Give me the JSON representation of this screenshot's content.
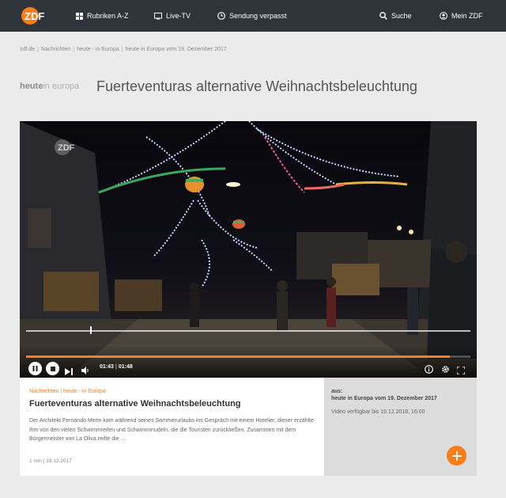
{
  "header": {
    "logo_text": "ZDF",
    "nav": {
      "rubriken": "Rubriken A-Z",
      "livetv": "Live-TV",
      "verpasst": "Sendung verpasst",
      "suche": "Suche",
      "meinzdf": "Mein ZDF"
    }
  },
  "breadcrumb": {
    "items": [
      "zdf.de",
      "Nachrichten",
      "heute - in Europa",
      "heute in Europa vom 19. Dezember 2017"
    ],
    "separator": "|"
  },
  "title_row": {
    "brand_bold": "heute",
    "brand_light": "in europa",
    "title": "Fuerteventuras alternative Weihnachtsbeleuchtung"
  },
  "player": {
    "watermark": "ZDF",
    "current_time": "01:43",
    "duration": "01:48",
    "time_separator": "|",
    "progress_fraction": 0.954,
    "accent": "#fa7d19"
  },
  "card": {
    "kicker": "Nachrichten | heute - in Europa",
    "title": "Fuerteventuras alternative Weihnachtsbeleuchtung",
    "description": "Der Architekt Fernando Merin kam während seines Sommerurlaubs ins Gespräch mit einem Hotelier, dieser erzählte ihm von den vielen Schwimmreifen und Schwimmnudeln, die die Touristen zurückließen. Zusammen mit dem Bürgermeister von La Oliva reifte die ...",
    "meta": "1 min | 19.12.2017"
  },
  "side": {
    "from_label": "aus:",
    "show": "heute in Europa vom 19. Dezember 2017",
    "availability": "Video verfügbar bis 19.12.2018, 16:00"
  },
  "colors": {
    "topbar": "#2f333a",
    "accent": "#fa7d19",
    "page_bg": "#ebebeb"
  },
  "icons": [
    "grid-icon",
    "tv-icon",
    "clock-icon",
    "search-icon",
    "user-icon",
    "pause-icon",
    "stop-icon",
    "skip-icon",
    "volume-icon",
    "info-icon",
    "gear-icon",
    "fullscreen-icon",
    "plus-icon"
  ]
}
